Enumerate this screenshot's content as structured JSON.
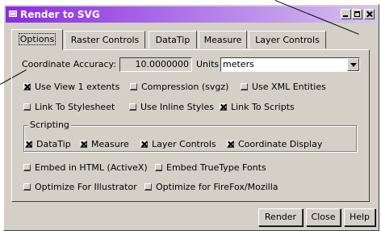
{
  "window": {
    "title": "Render to SVG"
  },
  "tabs": [
    {
      "label": "Options",
      "active": true
    },
    {
      "label": "Raster Controls",
      "active": false
    },
    {
      "label": "DataTip",
      "active": false
    },
    {
      "label": "Measure",
      "active": false
    },
    {
      "label": "Layer Controls",
      "active": false
    }
  ],
  "coordinate": {
    "accuracy_label": "Coordinate Accuracy:",
    "accuracy_value": "10.0000000",
    "units_label": "Units",
    "units_value": "meters"
  },
  "options_row1": [
    {
      "label": "Use View 1 extents",
      "checked": true
    },
    {
      "label": "Compression (svgz)",
      "checked": false
    },
    {
      "label": "Use XML Entities",
      "checked": false
    }
  ],
  "options_row2": [
    {
      "label": "Link To Stylesheet",
      "checked": false
    },
    {
      "label": "Use Inline Styles",
      "checked": false
    },
    {
      "label": "Link To Scripts",
      "checked": true
    }
  ],
  "scripting": {
    "title": "Scripting",
    "items": [
      {
        "label": "DataTip",
        "checked": true
      },
      {
        "label": "Measure",
        "checked": true
      },
      {
        "label": "Layer Controls",
        "checked": true
      },
      {
        "label": "Coordinate Display",
        "checked": true
      }
    ]
  },
  "options_row3": [
    {
      "label": "Embed in HTML (ActiveX)",
      "checked": false
    },
    {
      "label": "Embed TrueType Fonts",
      "checked": false
    }
  ],
  "options_row4": [
    {
      "label": "Optimize For Illustrator",
      "checked": false
    },
    {
      "label": "Optimize for FireFox/Mozilla",
      "checked": false
    }
  ],
  "buttons": {
    "render": "Render",
    "close": "Close",
    "help": "Help"
  },
  "colors": {
    "titlebar_start": "#8a2be2",
    "titlebar_end": "#d6c3f0",
    "face": "#d4d0c8"
  }
}
